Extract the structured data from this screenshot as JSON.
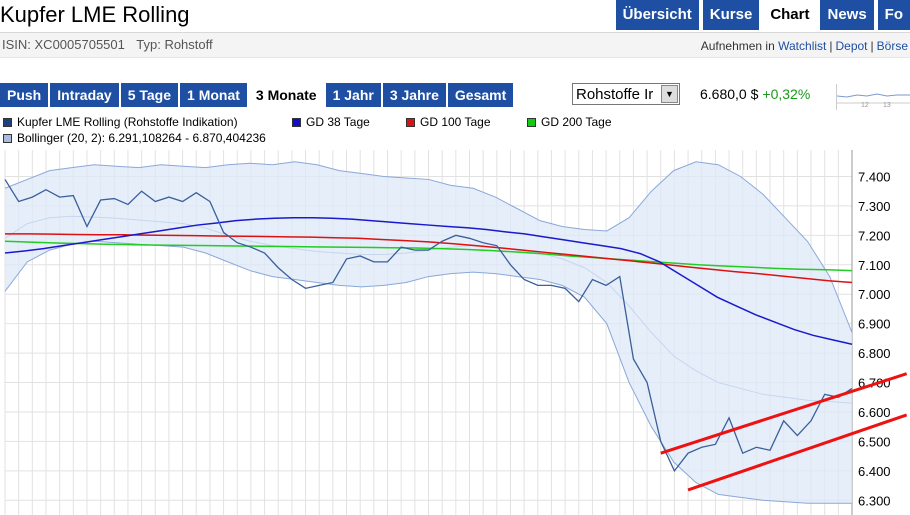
{
  "title": "Kupfer LME Rolling",
  "nav_tabs": [
    {
      "label": "Übersicht"
    },
    {
      "label": "Kurse"
    },
    {
      "label": "Chart"
    },
    {
      "label": "News"
    },
    {
      "label": "Fo"
    }
  ],
  "nav_active": "Chart",
  "isin_label": "ISIN: XC0005705501",
  "type_label": "Typ: Rohstoff",
  "actions": {
    "prefix": "Aufnehmen in",
    "watchlist": "Watchlist",
    "depot": "Depot",
    "boerse": "Börse"
  },
  "range_tabs": [
    {
      "label": "Push"
    },
    {
      "label": "Intraday"
    },
    {
      "label": "5 Tage"
    },
    {
      "label": "1 Monat"
    },
    {
      "label": "3 Monate"
    },
    {
      "label": "1 Jahr"
    },
    {
      "label": "3 Jahre"
    },
    {
      "label": "Gesamt"
    }
  ],
  "range_active": "3 Monate",
  "select_value": "Rohstoffe Ir",
  "price": {
    "value": "6.680,0 $",
    "change": "+0,32%",
    "change_color": "#1a9a1a"
  },
  "mini_chart_ticks": [
    "12",
    "13"
  ],
  "legend": [
    {
      "label": "Kupfer LME Rolling (Rohstoffe Indikation)",
      "color": "#1f3f7f"
    },
    {
      "label": "GD 38 Tage",
      "color": "#1010cc"
    },
    {
      "label": "GD 100 Tage",
      "color": "#dd1111"
    },
    {
      "label": "GD 200 Tage",
      "color": "#11cc11"
    },
    {
      "label": "Bollinger (20, 2): 6.291,108264 - 6.870,404236",
      "color": "#aabbdd"
    }
  ],
  "chart_data": {
    "type": "line",
    "y_ticks": [
      "7.400",
      "7.300",
      "7.200",
      "7.100",
      "7.000",
      "6.900",
      "6.800",
      "6.700",
      "6.600",
      "6.500",
      "6.400",
      "6.300"
    ],
    "ylim": [
      6250,
      7490
    ],
    "grid": true,
    "series": [
      {
        "name": "Kupfer LME Rolling (Rohstoffe Indikation)",
        "color": "#3a5f9a",
        "values": [
          7390,
          7315,
          7330,
          7355,
          7330,
          7335,
          7230,
          7320,
          7325,
          7305,
          7350,
          7315,
          7330,
          7315,
          7345,
          7315,
          7210,
          7175,
          7160,
          7140,
          7090,
          7050,
          7020,
          7030,
          7040,
          7120,
          7130,
          7110,
          7110,
          7160,
          7150,
          7150,
          7180,
          7200,
          7190,
          7175,
          7165,
          7100,
          7050,
          7030,
          7030,
          7020,
          6975,
          7050,
          7030,
          7060,
          6780,
          6700,
          6500,
          6400,
          6460,
          6480,
          6490,
          6580,
          6460,
          6480,
          6470,
          6570,
          6520,
          6570,
          6660,
          6650,
          6680
        ]
      },
      {
        "name": "GD 38 Tage",
        "color": "#1a1acc",
        "values": [
          7140,
          7147,
          7155,
          7165,
          7175,
          7185,
          7195,
          7205,
          7215,
          7225,
          7235,
          7242,
          7250,
          7255,
          7258,
          7260,
          7260,
          7258,
          7255,
          7250,
          7245,
          7240,
          7235,
          7230,
          7226,
          7220,
          7212,
          7205,
          7195,
          7185,
          7175,
          7165,
          7155,
          7138,
          7110,
          7070,
          7030,
          6990,
          6960,
          6930,
          6905,
          6880,
          6860,
          6845,
          6830
        ]
      },
      {
        "name": "GD 100 Tage",
        "color": "#dd1111",
        "values": [
          7205,
          7205,
          7204,
          7203,
          7202,
          7202,
          7201,
          7200,
          7199,
          7198,
          7197,
          7196,
          7195,
          7194,
          7192,
          7190,
          7186,
          7182,
          7178,
          7172,
          7165,
          7158,
          7150,
          7142,
          7134,
          7126,
          7118,
          7110,
          7102,
          7093,
          7085,
          7077,
          7070,
          7062,
          7054,
          7046,
          7040
        ]
      },
      {
        "name": "GD 200 Tage",
        "color": "#22cc22",
        "values": [
          7180,
          7177,
          7174,
          7172,
          7170,
          7168,
          7167,
          7166,
          7165,
          7164,
          7163,
          7162,
          7161,
          7160,
          7159,
          7158,
          7157,
          7155,
          7152,
          7148,
          7143,
          7137,
          7130,
          7124,
          7118,
          7112,
          7106,
          7100,
          7096,
          7092,
          7088,
          7085,
          7083,
          7080
        ]
      },
      {
        "name": "Bollinger upper",
        "color": "#8aa8d8",
        "values": [
          7360,
          7390,
          7420,
          7430,
          7440,
          7435,
          7430,
          7440,
          7435,
          7430,
          7440,
          7445,
          7440,
          7450,
          7440,
          7420,
          7410,
          7400,
          7395,
          7390,
          7370,
          7360,
          7330,
          7290,
          7250,
          7230,
          7220,
          7215,
          7260,
          7350,
          7420,
          7450,
          7440,
          7400,
          7340,
          7260,
          7180,
          7060,
          6870
        ]
      },
      {
        "name": "Bollinger lower",
        "color": "#8aa8d8",
        "values": [
          7010,
          7110,
          7150,
          7170,
          7180,
          7175,
          7170,
          7165,
          7160,
          7140,
          7110,
          7080,
          7060,
          7050,
          7040,
          7030,
          7025,
          7030,
          7040,
          7060,
          7070,
          7075,
          7070,
          7060,
          7050,
          7030,
          6990,
          6900,
          6700,
          6550,
          6430,
          6360,
          6320,
          6310,
          6300,
          6295,
          6290,
          6290,
          6290
        ]
      },
      {
        "name": "Bollinger middle",
        "color": "#c6d6ee",
        "values": [
          7190,
          7240,
          7260,
          7265,
          7262,
          7258,
          7252,
          7246,
          7240,
          7225,
          7200,
          7180,
          7165,
          7155,
          7145,
          7140,
          7135,
          7135,
          7140,
          7150,
          7160,
          7165,
          7160,
          7150,
          7140,
          7120,
          7090,
          7040,
          6960,
          6870,
          6790,
          6740,
          6700,
          6680,
          6660,
          6650,
          6640,
          6635,
          6630
        ]
      }
    ],
    "annotations": [
      {
        "type": "trendline",
        "color": "#ee1111",
        "from": [
          48,
          6460
        ],
        "to": [
          66,
          6730
        ]
      },
      {
        "type": "trendline",
        "color": "#ee1111",
        "from": [
          50,
          6335
        ],
        "to": [
          66,
          6590
        ]
      }
    ]
  }
}
